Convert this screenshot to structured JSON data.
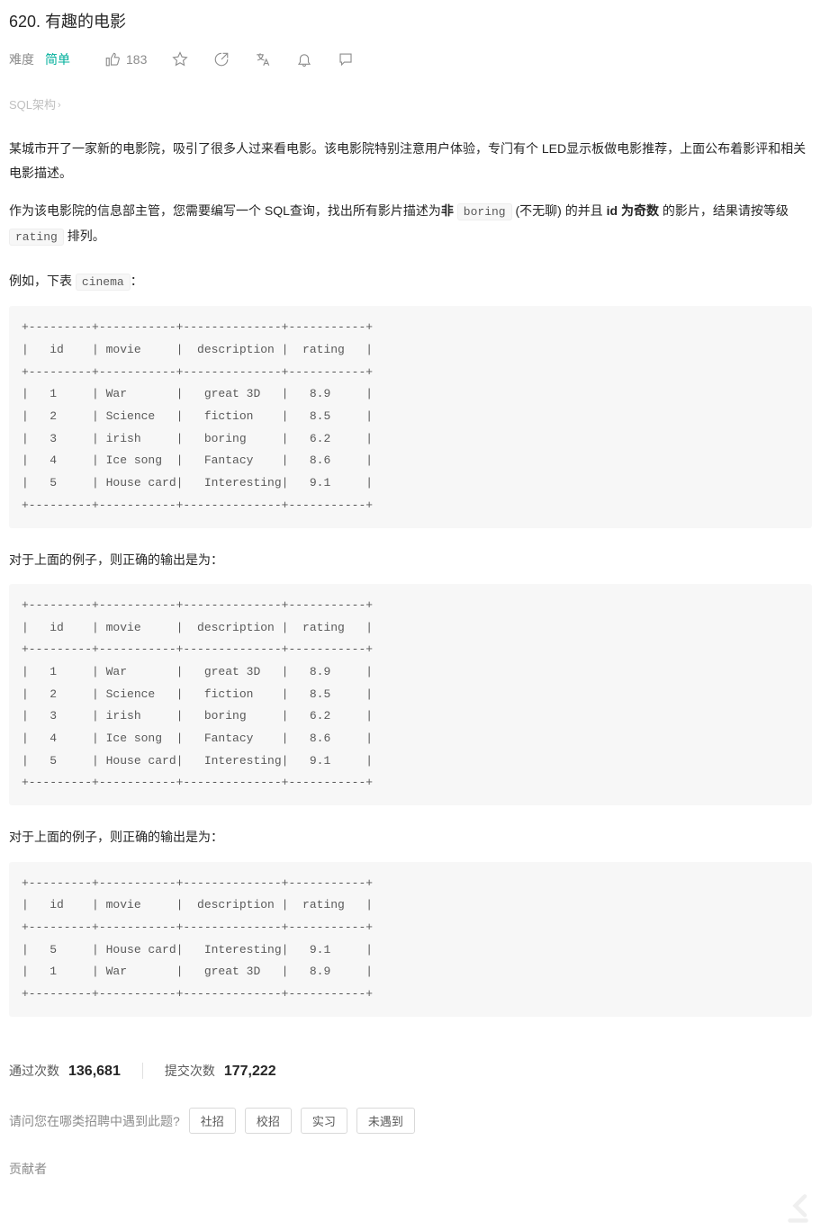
{
  "header": {
    "problem_number": "620.",
    "problem_title": "有趣的电影",
    "difficulty_label": "难度",
    "difficulty_value": "简单",
    "likes": "183"
  },
  "sql_schema": {
    "label": "SQL架构",
    "chevron": "›"
  },
  "description": {
    "para1": "某城市开了一家新的电影院，吸引了很多人过来看电影。该电影院特别注意用户体验，专门有个 LED显示板做电影推荐，上面公布着影评和相关电影描述。",
    "para2_prefix": "作为该电影院的信息部主管，您需要编写一个 SQL查询，找出所有影片描述为",
    "para2_bold1": "非",
    "para2_code1": "boring",
    "para2_mid1": "(不无聊) 的并且 ",
    "para2_bold2": "id 为奇数",
    "para2_mid2": " 的影片，结果请按等级 ",
    "para2_code2": "rating",
    "para2_suffix": " 排列。",
    "example_prefix": "例如，下表 ",
    "example_code": "cinema",
    "example_suffix": "：",
    "output_label": "对于上面的例子，则正确的输出是为："
  },
  "codeblocks": {
    "table1": "+---------+-----------+--------------+-----------+\n|   id    | movie     |  description |  rating   |\n+---------+-----------+--------------+-----------+\n|   1     | War       |   great 3D   |   8.9     |\n|   2     | Science   |   fiction    |   8.5     |\n|   3     | irish     |   boring     |   6.2     |\n|   4     | Ice song  |   Fantacy    |   8.6     |\n|   5     | House card|   Interesting|   9.1     |\n+---------+-----------+--------------+-----------+",
    "table2": "+---------+-----------+--------------+-----------+\n|   id    | movie     |  description |  rating   |\n+---------+-----------+--------------+-----------+\n|   1     | War       |   great 3D   |   8.9     |\n|   2     | Science   |   fiction    |   8.5     |\n|   3     | irish     |   boring     |   6.2     |\n|   4     | Ice song  |   Fantacy    |   8.6     |\n|   5     | House card|   Interesting|   9.1     |\n+---------+-----------+--------------+-----------+",
    "table3": "+---------+-----------+--------------+-----------+\n|   id    | movie     |  description |  rating   |\n+---------+-----------+--------------+-----------+\n|   5     | House card|   Interesting|   9.1     |\n|   1     | War       |   great 3D   |   8.9     |\n+---------+-----------+--------------+-----------+"
  },
  "stats": {
    "accepted_label": "通过次数",
    "accepted_value": "136,681",
    "submissions_label": "提交次数",
    "submissions_value": "177,222"
  },
  "survey": {
    "label": "请问您在哪类招聘中遇到此题?",
    "options": [
      "社招",
      "校招",
      "实习",
      "未遇到"
    ]
  },
  "contributors": {
    "label": "贡献者"
  }
}
